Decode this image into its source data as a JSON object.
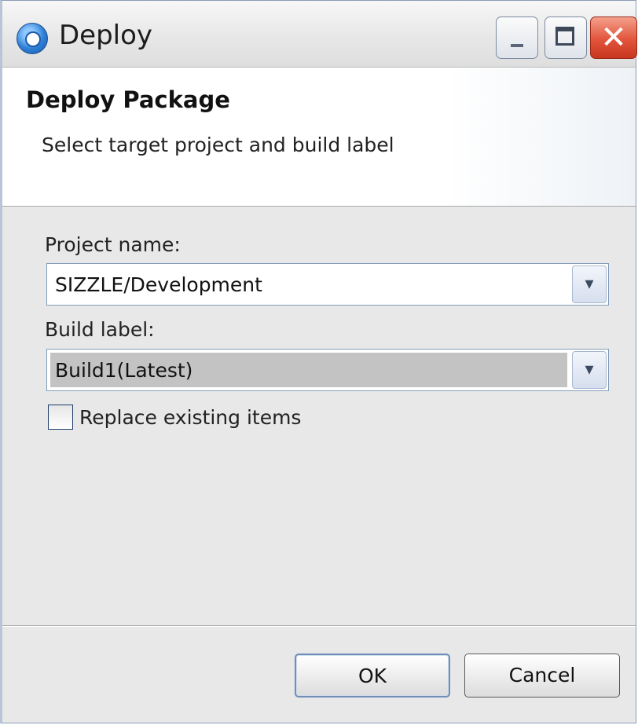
{
  "window": {
    "title": "Deploy",
    "icon": "deploy-app-icon",
    "controls": {
      "minimize_icon": "minimize-icon",
      "maximize_icon": "maximize-icon",
      "close_glyph": "✕"
    }
  },
  "header": {
    "title": "Deploy Package",
    "description": "Select target project and build label"
  },
  "form": {
    "project": {
      "label": "Project name:",
      "value": "SIZZLE/Development"
    },
    "build": {
      "label": "Build label:",
      "value": "Build1(Latest)"
    },
    "replace": {
      "label": "Replace existing items",
      "checked": false
    },
    "dropdown_glyph": "▾"
  },
  "buttons": {
    "ok": "OK",
    "cancel": "Cancel"
  }
}
